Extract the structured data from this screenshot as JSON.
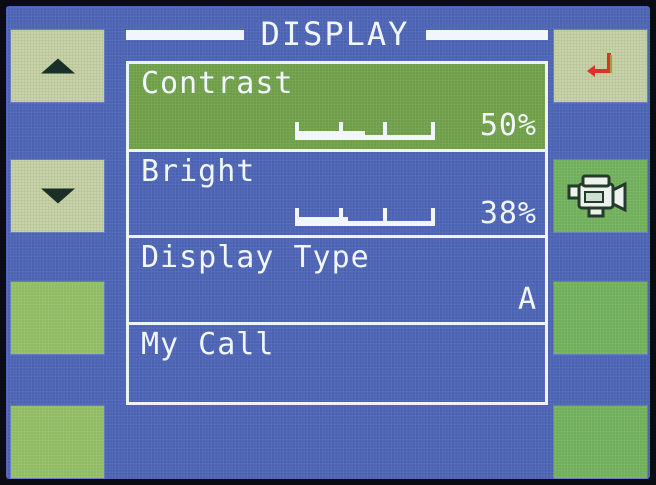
{
  "title": "DISPLAY",
  "menu": [
    {
      "label": "Contrast",
      "value": "50%",
      "level": 0.5,
      "selected": true
    },
    {
      "label": "Bright",
      "value": "38%",
      "level": 0.38,
      "selected": false
    },
    {
      "label": "Display Type",
      "value": "A"
    },
    {
      "label": "My Call",
      "value": ""
    }
  ],
  "softkeys": {
    "left": [
      "up-arrow-icon",
      "down-arrow-icon",
      "",
      ""
    ],
    "right": [
      "return-icon",
      "camcorder-icon",
      "",
      ""
    ]
  },
  "colors": {
    "screen": "#4d65b5",
    "selected": "#6f9e48",
    "text": "#f1f5fc",
    "key": "#c8d2a7",
    "key_green": "#8fbc63"
  }
}
